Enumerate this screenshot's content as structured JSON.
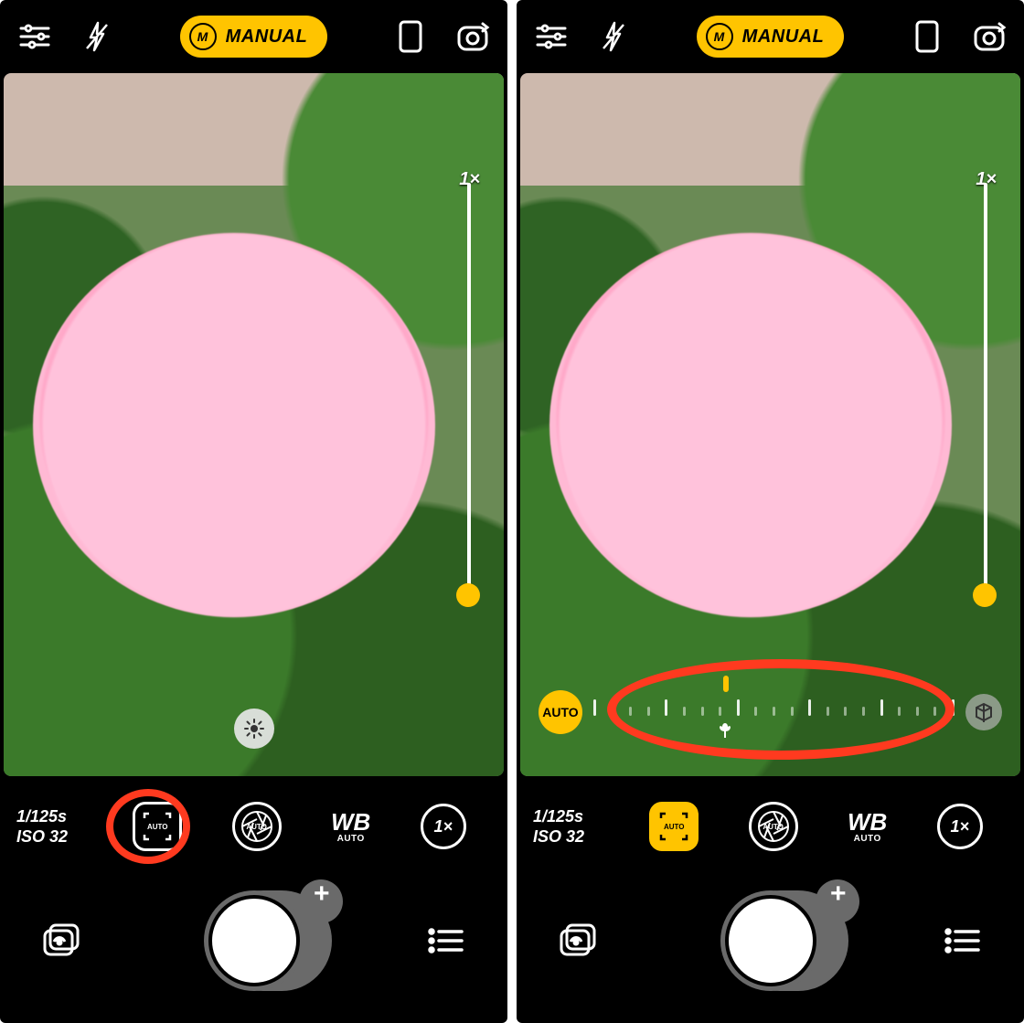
{
  "mode": {
    "badge": "M",
    "label": "MANUAL"
  },
  "zoom": {
    "label": "1×"
  },
  "exposure": {
    "shutter": "1/125s",
    "iso": "ISO 32"
  },
  "controls": {
    "focus_label": "AUTO",
    "aperture_label": "AUTO",
    "wb_label": "WB",
    "wb_sub": "AUTO",
    "zoom_label": "1×"
  },
  "focus_panel": {
    "auto_chip": "AUTO"
  },
  "shutter": {
    "plus": "+"
  },
  "panes": {
    "left": {
      "focus_active": false,
      "show_focus_slider": false,
      "show_bright_btn": true
    },
    "right": {
      "focus_active": true,
      "show_focus_slider": true,
      "show_bright_btn": false
    }
  }
}
